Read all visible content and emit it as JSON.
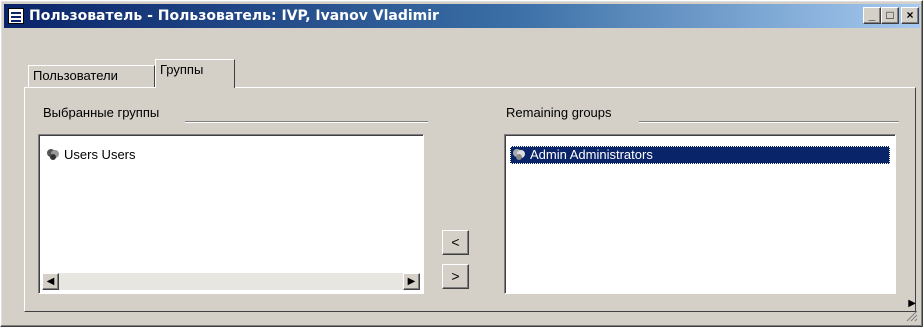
{
  "window": {
    "title": "Пользователь - Пользователь: IVP, Ivanov Vladimir",
    "controls": {
      "minimize": "_",
      "maximize": "□",
      "close": "×"
    }
  },
  "tabs": [
    {
      "label": "Пользователи",
      "active": false
    },
    {
      "label": "Группы",
      "active": true
    }
  ],
  "selected_groups": {
    "label": "Выбранные группы",
    "items": [
      {
        "icon": "group-icon",
        "text": "Users   Users"
      }
    ]
  },
  "remaining_groups": {
    "label": "Remaining groups",
    "items": [
      {
        "icon": "group-icon",
        "text": "Admin   Administrators",
        "selected": true
      }
    ]
  },
  "buttons": {
    "move_left": "<",
    "move_right": ">"
  },
  "scrollbar": {
    "left_arrow": "◀",
    "right_arrow": "▶"
  },
  "colors": {
    "titlebar_start": "#0a246a",
    "titlebar_end": "#a6caf0",
    "selection": "#0a246a",
    "face": "#d4d0c8"
  }
}
